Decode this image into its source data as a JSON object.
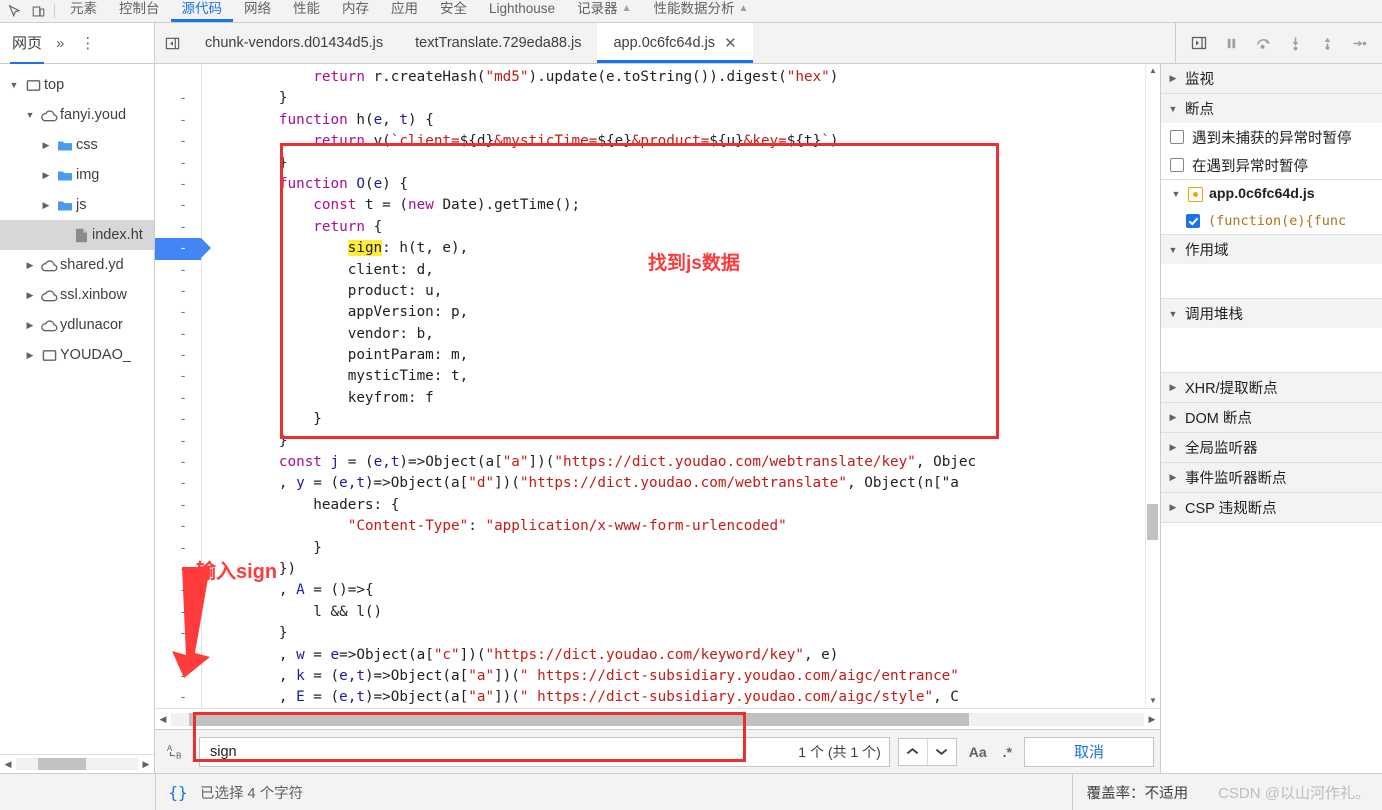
{
  "devtools": {
    "main_tabs": [
      {
        "label": "元素"
      },
      {
        "label": "控制台"
      },
      {
        "label": "源代码",
        "selected": true
      },
      {
        "label": "网络"
      },
      {
        "label": "性能"
      },
      {
        "label": "内存"
      },
      {
        "label": "应用"
      },
      {
        "label": "安全"
      },
      {
        "label": "Lighthouse"
      },
      {
        "label": "记录器",
        "warn": true
      },
      {
        "label": "性能数据分析",
        "warn": true
      }
    ],
    "inspect_icon": "inspect-element-icon",
    "device_icon": "device-toolbar-icon"
  },
  "navigator": {
    "tabs": [
      {
        "label": "网页",
        "selected": true
      }
    ],
    "more_label": "»",
    "menu_label": "⋮",
    "tree": [
      {
        "label": "top",
        "icon": "frame-icon",
        "depth": 0,
        "twisty": "open"
      },
      {
        "label": "fanyi.youd",
        "icon": "cloud-icon",
        "depth": 1,
        "twisty": "open"
      },
      {
        "label": "css",
        "icon": "folder-icon",
        "depth": 2,
        "twisty": "closed"
      },
      {
        "label": "img",
        "icon": "folder-icon",
        "depth": 2,
        "twisty": "closed"
      },
      {
        "label": "js",
        "icon": "folder-icon",
        "depth": 2,
        "twisty": "closed"
      },
      {
        "label": "index.ht",
        "icon": "file-icon",
        "depth": 3,
        "twisty": "none",
        "selected": true
      },
      {
        "label": "shared.yd",
        "icon": "cloud-icon",
        "depth": 1,
        "twisty": "closed"
      },
      {
        "label": "ssl.xinbow",
        "icon": "cloud-icon",
        "depth": 1,
        "twisty": "closed"
      },
      {
        "label": "ydlunacor",
        "icon": "cloud-icon",
        "depth": 1,
        "twisty": "closed"
      },
      {
        "label": "YOUDAO_",
        "icon": "frame-icon",
        "depth": 1,
        "twisty": "closed"
      }
    ]
  },
  "file_tabs": {
    "sidebar_toggle_icon": "show-navigator-icon",
    "items": [
      {
        "label": "chunk-vendors.d01434d5.js",
        "selected": false,
        "closable": false
      },
      {
        "label": "textTranslate.729eda88.js",
        "selected": false,
        "closable": false
      },
      {
        "label": "app.0c6fc64d.js",
        "selected": true,
        "closable": true
      }
    ],
    "close_glyph": "✕"
  },
  "debug_buttons": [
    {
      "name": "pause-script-button",
      "glyph": "pause"
    },
    {
      "name": "step-over-button",
      "glyph": "step-over"
    },
    {
      "name": "step-into-button",
      "glyph": "step-into"
    },
    {
      "name": "step-out-button",
      "glyph": "step-out"
    },
    {
      "name": "step-button",
      "glyph": "step"
    }
  ],
  "editor": {
    "lines": [
      {
        "num": "",
        "segments": [
          {
            "t": "            ",
            "c": ""
          },
          {
            "t": "return ",
            "c": "k"
          },
          {
            "t": "r.createHash(",
            "c": ""
          },
          {
            "t": "\"md5\"",
            "c": "s"
          },
          {
            "t": ").update(e.toString()).digest(",
            "c": ""
          },
          {
            "t": "\"hex\"",
            "c": "s"
          },
          {
            "t": ")",
            "c": ""
          }
        ]
      },
      {
        "num": "-",
        "segments": [
          {
            "t": "        }",
            "c": ""
          }
        ]
      },
      {
        "num": "-",
        "segments": [
          {
            "t": "        ",
            "c": ""
          },
          {
            "t": "function ",
            "c": "k"
          },
          {
            "t": "h",
            "c": ""
          },
          {
            "t": "(",
            "c": ""
          },
          {
            "t": "e",
            "c": "v"
          },
          {
            "t": ", ",
            "c": ""
          },
          {
            "t": "t",
            "c": "v"
          },
          {
            "t": ") {",
            "c": ""
          }
        ]
      },
      {
        "num": "-",
        "segments": [
          {
            "t": "            ",
            "c": ""
          },
          {
            "t": "return ",
            "c": "k"
          },
          {
            "t": "v(",
            "c": ""
          },
          {
            "t": "`client=",
            "c": "s"
          },
          {
            "t": "${d}",
            "c": ""
          },
          {
            "t": "&mysticTime=",
            "c": "s"
          },
          {
            "t": "${e}",
            "c": ""
          },
          {
            "t": "&product=",
            "c": "s"
          },
          {
            "t": "${u}",
            "c": ""
          },
          {
            "t": "&key=",
            "c": "s"
          },
          {
            "t": "${t}",
            "c": ""
          },
          {
            "t": "`",
            "c": "s"
          },
          {
            "t": ")",
            "c": ""
          }
        ]
      },
      {
        "num": "-",
        "segments": [
          {
            "t": "        }",
            "c": ""
          }
        ]
      },
      {
        "num": "-",
        "segments": [
          {
            "t": "        ",
            "c": ""
          },
          {
            "t": "function ",
            "c": "k"
          },
          {
            "t": "O",
            "c": "v"
          },
          {
            "t": "(",
            "c": ""
          },
          {
            "t": "e",
            "c": "v"
          },
          {
            "t": ") {",
            "c": ""
          }
        ]
      },
      {
        "num": "-",
        "segments": [
          {
            "t": "            ",
            "c": ""
          },
          {
            "t": "const ",
            "c": "k"
          },
          {
            "t": "t ",
            "c": ""
          },
          {
            "t": "= (",
            "c": ""
          },
          {
            "t": "new ",
            "c": "k"
          },
          {
            "t": "Date).getTime();",
            "c": ""
          }
        ]
      },
      {
        "num": "-",
        "segments": [
          {
            "t": "            ",
            "c": ""
          },
          {
            "t": "return ",
            "c": "k"
          },
          {
            "t": "{",
            "c": ""
          }
        ]
      },
      {
        "num": "-",
        "segments": [
          {
            "t": "                ",
            "c": ""
          },
          {
            "t": "sign",
            "c": "hl"
          },
          {
            "t": ": h(t, e),",
            "c": ""
          }
        ],
        "breakpoint": true
      },
      {
        "num": "-",
        "segments": [
          {
            "t": "                client: d,",
            "c": ""
          }
        ]
      },
      {
        "num": "-",
        "segments": [
          {
            "t": "                product: u,",
            "c": ""
          }
        ]
      },
      {
        "num": "-",
        "segments": [
          {
            "t": "                appVersion: p,",
            "c": ""
          }
        ]
      },
      {
        "num": "-",
        "segments": [
          {
            "t": "                vendor: b,",
            "c": ""
          }
        ]
      },
      {
        "num": "-",
        "segments": [
          {
            "t": "                pointParam: m,",
            "c": ""
          }
        ]
      },
      {
        "num": "-",
        "segments": [
          {
            "t": "                mysticTime: t,",
            "c": ""
          }
        ]
      },
      {
        "num": "-",
        "segments": [
          {
            "t": "                keyfrom: f",
            "c": ""
          }
        ]
      },
      {
        "num": "-",
        "segments": [
          {
            "t": "            }",
            "c": ""
          }
        ]
      },
      {
        "num": "-",
        "segments": [
          {
            "t": "        }",
            "c": ""
          }
        ]
      },
      {
        "num": "-",
        "segments": [
          {
            "t": "        ",
            "c": ""
          },
          {
            "t": "const ",
            "c": "k"
          },
          {
            "t": "j ",
            "c": "v"
          },
          {
            "t": "= (",
            "c": ""
          },
          {
            "t": "e,t",
            "c": "v"
          },
          {
            "t": ")=>Object(a[",
            "c": ""
          },
          {
            "t": "\"a\"",
            "c": "s"
          },
          {
            "t": "])(",
            "c": ""
          },
          {
            "t": "\"https://dict.youdao.com/webtranslate/key\"",
            "c": "s"
          },
          {
            "t": ", Objec",
            "c": ""
          }
        ]
      },
      {
        "num": "-",
        "segments": [
          {
            "t": "        , ",
            "c": ""
          },
          {
            "t": "y ",
            "c": "v"
          },
          {
            "t": "= (",
            "c": ""
          },
          {
            "t": "e,t",
            "c": "v"
          },
          {
            "t": ")=>Object(a[",
            "c": ""
          },
          {
            "t": "\"d\"",
            "c": "s"
          },
          {
            "t": "])(",
            "c": ""
          },
          {
            "t": "\"https://dict.youdao.com/webtranslate\"",
            "c": "s"
          },
          {
            "t": ", Object(n[\"a",
            "c": ""
          }
        ]
      },
      {
        "num": "-",
        "segments": [
          {
            "t": "            headers: {",
            "c": ""
          }
        ]
      },
      {
        "num": "-",
        "segments": [
          {
            "t": "                ",
            "c": ""
          },
          {
            "t": "\"Content-Type\"",
            "c": "s"
          },
          {
            "t": ": ",
            "c": ""
          },
          {
            "t": "\"application/x-www-form-urlencoded\"",
            "c": "s"
          }
        ]
      },
      {
        "num": "-",
        "segments": [
          {
            "t": "            }",
            "c": ""
          }
        ]
      },
      {
        "num": "-",
        "segments": [
          {
            "t": "        })",
            "c": ""
          }
        ]
      },
      {
        "num": "-",
        "segments": [
          {
            "t": "        , ",
            "c": ""
          },
          {
            "t": "A ",
            "c": "v"
          },
          {
            "t": "= ()=>{",
            "c": ""
          }
        ]
      },
      {
        "num": "-",
        "segments": [
          {
            "t": "            l && l()",
            "c": ""
          }
        ]
      },
      {
        "num": "-",
        "segments": [
          {
            "t": "        }",
            "c": ""
          }
        ]
      },
      {
        "num": "-",
        "segments": [
          {
            "t": "        , ",
            "c": ""
          },
          {
            "t": "w ",
            "c": "v"
          },
          {
            "t": "= ",
            "c": ""
          },
          {
            "t": "e",
            "c": "v"
          },
          {
            "t": "=>Object(a[",
            "c": ""
          },
          {
            "t": "\"c\"",
            "c": "s"
          },
          {
            "t": "])(",
            "c": ""
          },
          {
            "t": "\"https://dict.youdao.com/keyword/key\"",
            "c": "s"
          },
          {
            "t": ", e)",
            "c": ""
          }
        ]
      },
      {
        "num": "-",
        "segments": [
          {
            "t": "        , ",
            "c": ""
          },
          {
            "t": "k ",
            "c": "v"
          },
          {
            "t": "= (",
            "c": ""
          },
          {
            "t": "e,t",
            "c": "v"
          },
          {
            "t": ")=>Object(a[",
            "c": ""
          },
          {
            "t": "\"a\"",
            "c": "s"
          },
          {
            "t": "])(",
            "c": ""
          },
          {
            "t": "\" https://dict-subsidiary.youdao.com/aigc/entrance\"",
            "c": "s"
          }
        ]
      },
      {
        "num": "-",
        "segments": [
          {
            "t": "        , ",
            "c": ""
          },
          {
            "t": "E ",
            "c": "v"
          },
          {
            "t": "= (",
            "c": ""
          },
          {
            "t": "e,t",
            "c": "v"
          },
          {
            "t": ")=>Object(a[",
            "c": ""
          },
          {
            "t": "\"a\"",
            "c": "s"
          },
          {
            "t": "])(",
            "c": ""
          },
          {
            "t": "\" https://dict-subsidiary.youdao.com/aigc/style\"",
            "c": "s"
          },
          {
            "t": ", C",
            "c": ""
          }
        ]
      }
    ]
  },
  "search": {
    "icon": "replace-icon",
    "value": "sign",
    "placeholder": "",
    "count_label": "1 个 (共 1 个)",
    "prev_glyph": "∧",
    "next_glyph": "∨",
    "match_case_label": "Aa",
    "regex_label": ".*",
    "cancel_label": "取消"
  },
  "statusbar": {
    "format_icon": "{}",
    "selection_text": "已选择 4 个字符",
    "coverage_text": "覆盖率：不适用",
    "watermark": "CSDN @以山河作礼。"
  },
  "debugpane": {
    "sections": [
      {
        "title": "监视",
        "open": false
      },
      {
        "title": "断点",
        "open": true
      },
      {
        "title": "作用域",
        "open": true
      },
      {
        "title": "调用堆栈",
        "open": true
      },
      {
        "title": "XHR/提取断点",
        "open": false
      },
      {
        "title": "DOM 断点",
        "open": false
      },
      {
        "title": "全局监听器",
        "open": false
      },
      {
        "title": "事件监听器断点",
        "open": false
      },
      {
        "title": "CSP 违规断点",
        "open": false
      }
    ],
    "pause_options": [
      {
        "label": "遇到未捕获的异常时暂停",
        "checked": false
      },
      {
        "label": "在遇到异常时暂停",
        "checked": false
      }
    ],
    "breakpoint_file": "app.0c6fc64d.js",
    "breakpoint_entry": "(function(e){func"
  },
  "annotations": [
    {
      "name": "found-js-data-note",
      "text": "找到js数据"
    },
    {
      "name": "input-sign-note",
      "text": "输入sign"
    }
  ],
  "colors": {
    "accent": "#1a73e8",
    "annotation_red": "#ea2f2f",
    "highlight_yellow": "#ffec3d",
    "string_red": "#c41a16",
    "keyword_purple": "#aa0d91"
  }
}
